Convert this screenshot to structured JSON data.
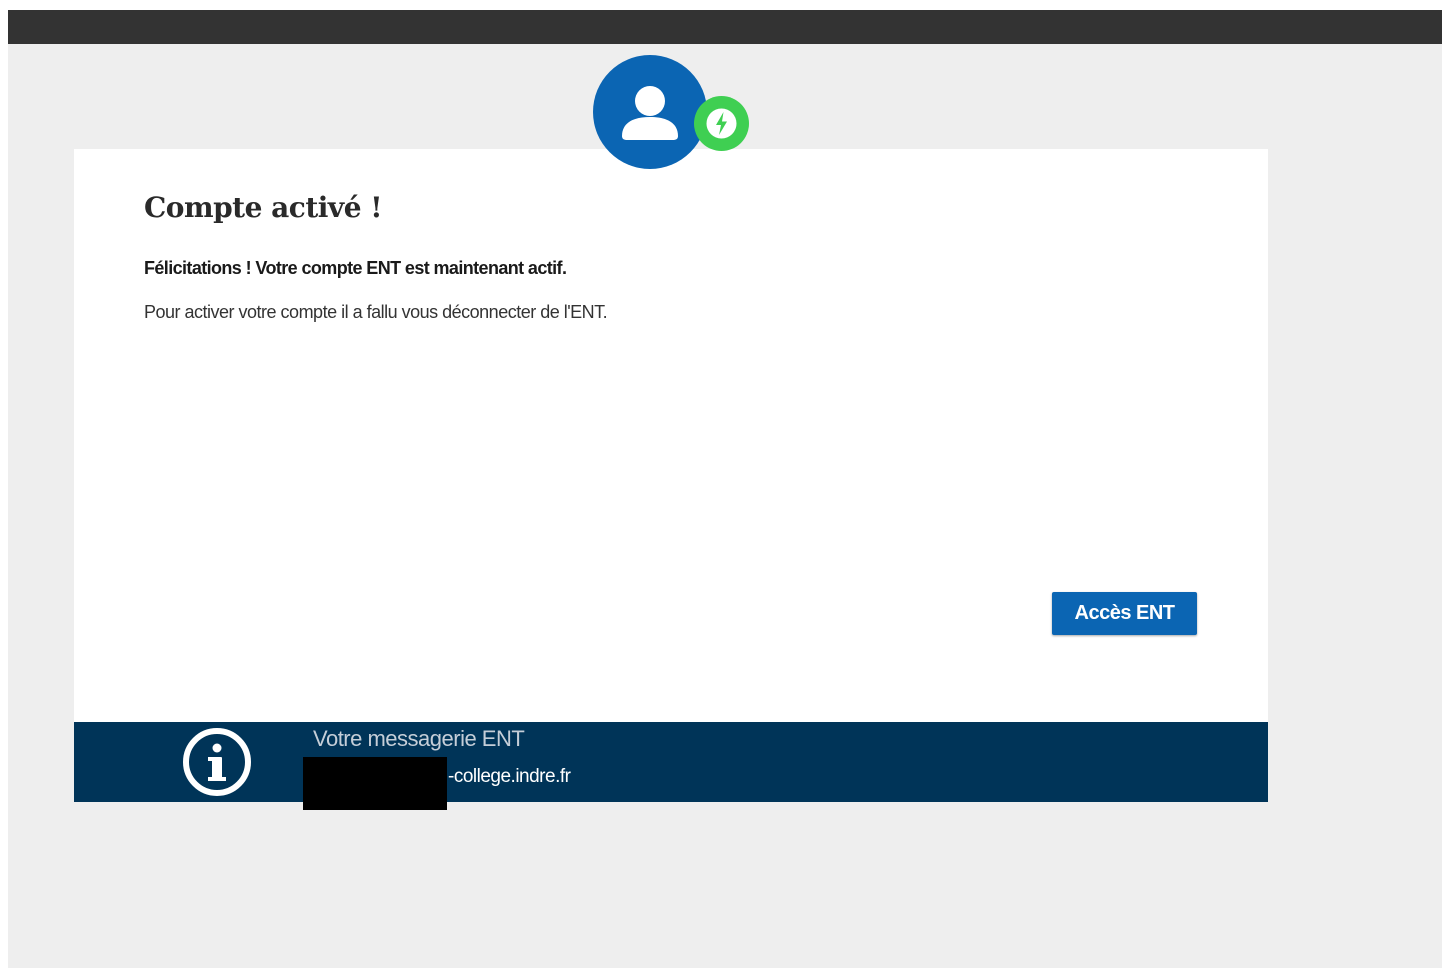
{
  "header": {
    "bar_color": "#333333"
  },
  "avatar": {
    "icon": "user-icon",
    "badge_icon": "lightning-bolt-icon",
    "color": "#0b65b3",
    "badge_color": "#3fcf52"
  },
  "card": {
    "title": "Compte activé !",
    "congrats": "Félicitations ! Votre compte ENT est maintenant actif.",
    "info": "Pour activer votre compte il a fallu vous déconnecter de l'ENT.",
    "access_button_label": "Accès ENT",
    "accent_color": "#0b65b3"
  },
  "footer": {
    "icon": "info-circle-icon",
    "label": "Votre messagerie ENT",
    "email_suffix": "-college.indre.fr",
    "background": "#003458"
  }
}
